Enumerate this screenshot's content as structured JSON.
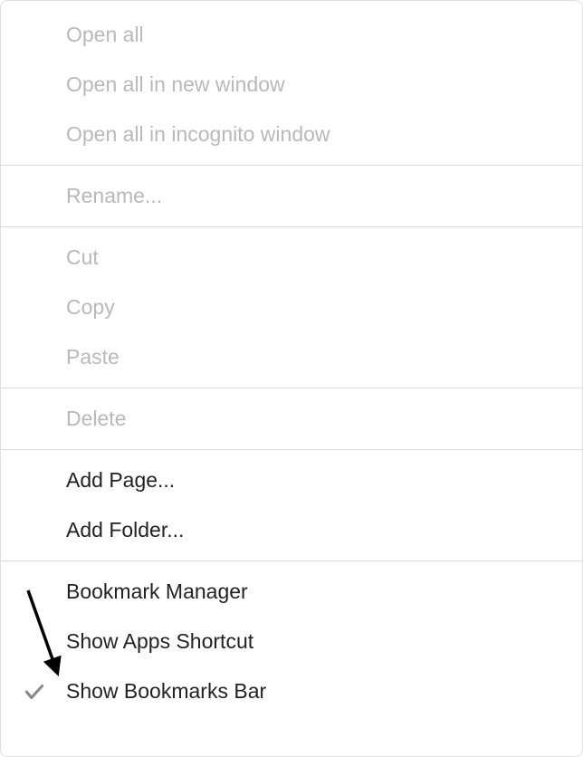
{
  "menu": {
    "sections": [
      [
        {
          "id": "open-all",
          "label": "Open all",
          "enabled": false,
          "checked": false
        },
        {
          "id": "open-all-new-window",
          "label": "Open all in new window",
          "enabled": false,
          "checked": false
        },
        {
          "id": "open-all-incognito",
          "label": "Open all in incognito window",
          "enabled": false,
          "checked": false
        }
      ],
      [
        {
          "id": "rename",
          "label": "Rename...",
          "enabled": false,
          "checked": false
        }
      ],
      [
        {
          "id": "cut",
          "label": "Cut",
          "enabled": false,
          "checked": false
        },
        {
          "id": "copy",
          "label": "Copy",
          "enabled": false,
          "checked": false
        },
        {
          "id": "paste",
          "label": "Paste",
          "enabled": false,
          "checked": false
        }
      ],
      [
        {
          "id": "delete",
          "label": "Delete",
          "enabled": false,
          "checked": false
        }
      ],
      [
        {
          "id": "add-page",
          "label": "Add Page...",
          "enabled": true,
          "checked": false
        },
        {
          "id": "add-folder",
          "label": "Add Folder...",
          "enabled": true,
          "checked": false
        }
      ],
      [
        {
          "id": "bookmark-manager",
          "label": "Bookmark Manager",
          "enabled": true,
          "checked": false
        },
        {
          "id": "show-apps-shortcut",
          "label": "Show Apps Shortcut",
          "enabled": true,
          "checked": false
        },
        {
          "id": "show-bookmarks-bar",
          "label": "Show Bookmarks Bar",
          "enabled": true,
          "checked": true
        }
      ]
    ]
  },
  "annotation": {
    "target": "show-apps-shortcut"
  }
}
